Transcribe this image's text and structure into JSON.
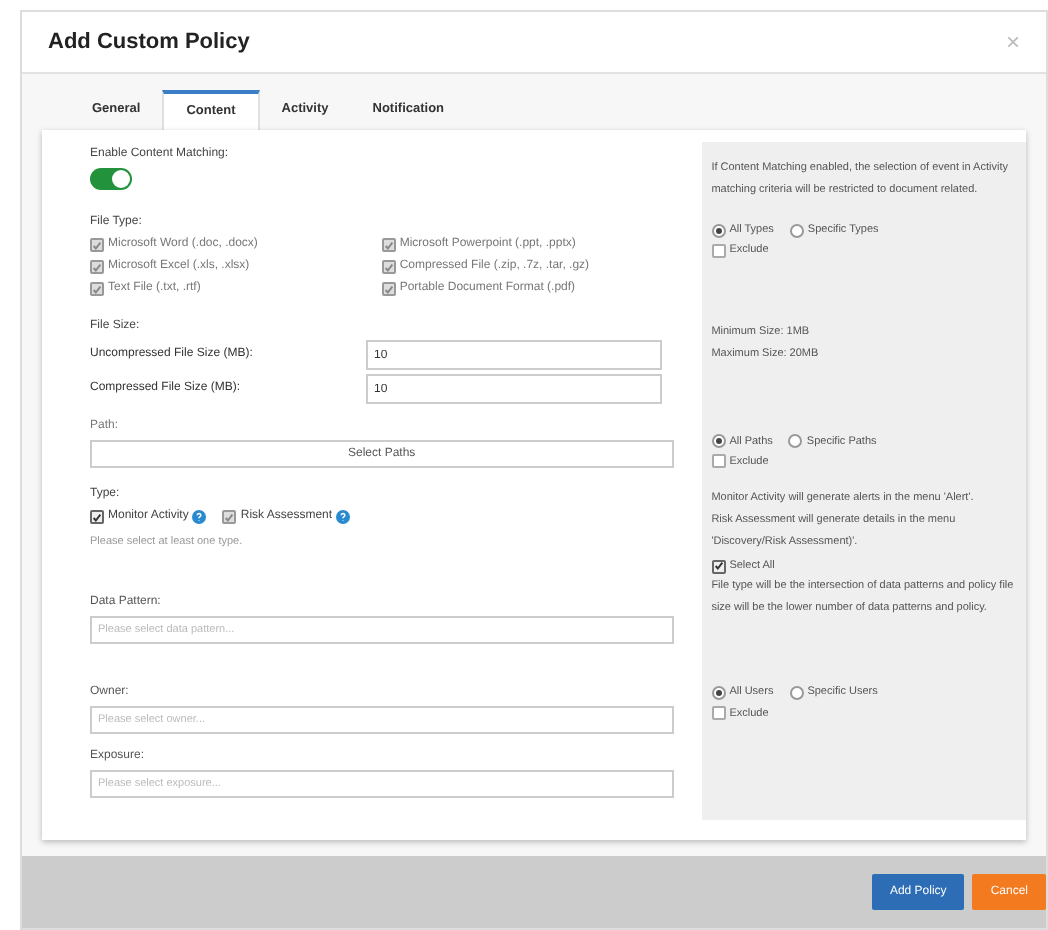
{
  "dialog": {
    "title": "Add Custom Policy",
    "close": "×"
  },
  "tabs": [
    {
      "label": "General",
      "selected": false
    },
    {
      "label": "Content",
      "selected": true
    },
    {
      "label": "Activity",
      "selected": false
    },
    {
      "label": "Notification",
      "selected": false
    }
  ],
  "content_matching": {
    "label": "Enable Content Matching:",
    "on": true
  },
  "file_type": {
    "label": "File Type:",
    "options": [
      {
        "label": "Microsoft Word (.doc, .docx)",
        "checked": true
      },
      {
        "label": "Microsoft Powerpoint (.ppt, .pptx)",
        "checked": true
      },
      {
        "label": "Microsoft Excel (.xls, .xlsx)",
        "checked": true
      },
      {
        "label": "Compressed File (.zip, .7z, .tar, .gz)",
        "checked": true
      },
      {
        "label": "Text File (.txt, .rtf)",
        "checked": true
      },
      {
        "label": "Portable Document Format (.pdf)",
        "checked": true
      }
    ]
  },
  "file_size": {
    "label": "File Size:",
    "fields": [
      {
        "label": "Uncompressed File Size (MB):",
        "value": "10"
      },
      {
        "label": "Compressed File Size (MB):",
        "value": "10"
      }
    ]
  },
  "path": {
    "label": "Path:",
    "button": "Select Paths"
  },
  "type": {
    "label": "Type:",
    "options": [
      {
        "label": "Monitor Activity",
        "checked": true
      },
      {
        "label": "Risk Assessment",
        "checked": true
      }
    ],
    "hint": "Please select at least one type."
  },
  "selects": [
    {
      "label": "Data Pattern:",
      "placeholder": "Please select data pattern..."
    },
    {
      "label": "Owner:",
      "placeholder": "Please select owner..."
    },
    {
      "label": "Exposure:",
      "placeholder": "Please select exposure..."
    }
  ],
  "side_panel": [
    {
      "items": [
        {
          "kind": "text",
          "text": "If Content Matching enabled, the selection of event in Activity matching criteria will be restricted to document related."
        },
        {
          "kind": "radios",
          "options": [
            {
              "label": "All Types",
              "selected": true
            },
            {
              "label": "Specific Types",
              "selected": false
            }
          ]
        },
        {
          "kind": "checkbox",
          "label": "Exclude",
          "checked": false
        }
      ]
    },
    {
      "items": [
        {
          "kind": "text",
          "text": "Minimum Size: 1MB"
        },
        {
          "kind": "text",
          "text": "Maximum Size: 20MB"
        }
      ]
    },
    {
      "items": [
        {
          "kind": "radios",
          "options": [
            {
              "label": "All Paths",
              "selected": true
            },
            {
              "label": "Specific Paths",
              "selected": false
            }
          ]
        },
        {
          "kind": "checkbox",
          "label": "Exclude",
          "checked": false
        }
      ]
    },
    {
      "items": [
        {
          "kind": "text",
          "text": "Monitor Activity will generate alerts in the menu 'Alert'."
        },
        {
          "kind": "text",
          "text": "Risk Assessment will generate details in the menu 'Discovery/Risk Assessment)'."
        },
        {
          "kind": "checkbox",
          "label": "Select All",
          "checked": true
        },
        {
          "kind": "text",
          "text": "File type will be the intersection of data patterns and policy file size will be the lower number of data patterns and policy."
        }
      ]
    },
    {
      "items": [
        {
          "kind": "radios",
          "options": [
            {
              "label": "All Users",
              "selected": true
            },
            {
              "label": "Specific Users",
              "selected": false
            }
          ]
        },
        {
          "kind": "checkbox",
          "label": "Exclude",
          "checked": false
        }
      ]
    }
  ],
  "footer": [
    {
      "label": "Add Policy",
      "kind": "primary"
    },
    {
      "label": "Cancel",
      "kind": "cancel"
    }
  ]
}
